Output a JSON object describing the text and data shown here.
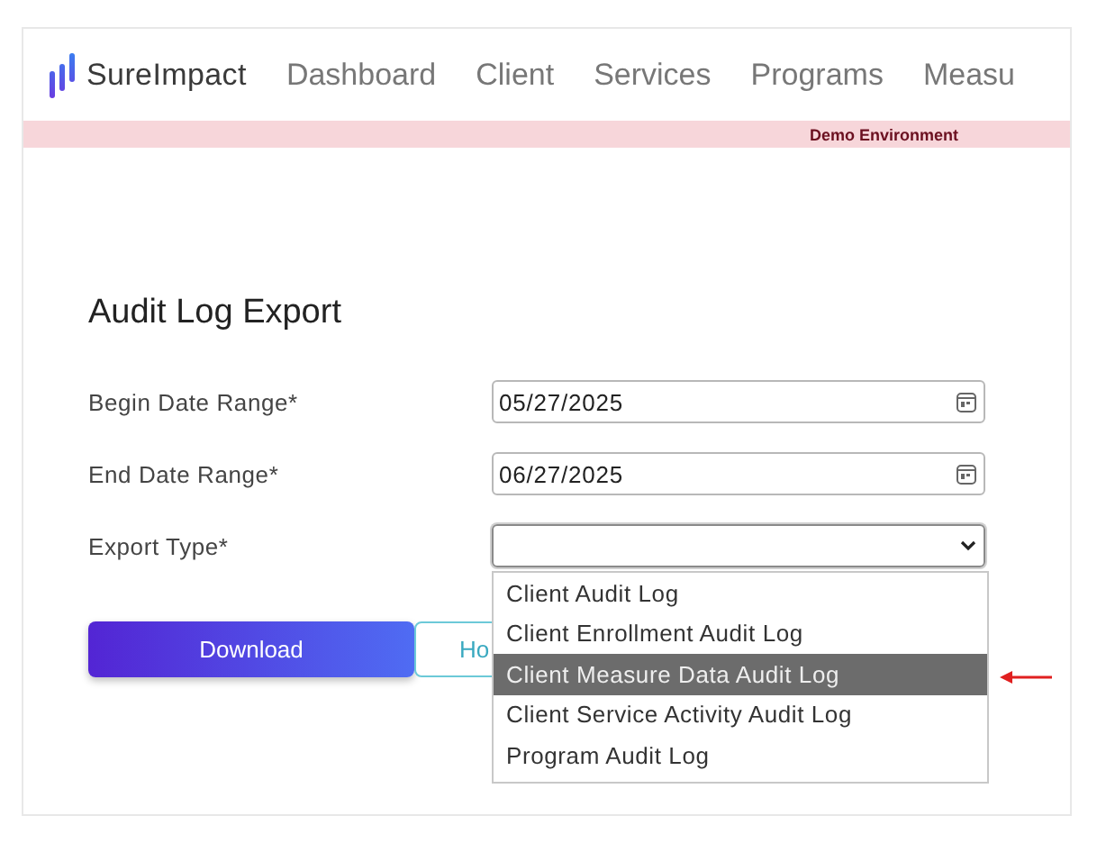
{
  "brand": {
    "name": "SureImpact"
  },
  "nav": [
    {
      "label": "Dashboard"
    },
    {
      "label": "Client"
    },
    {
      "label": "Services"
    },
    {
      "label": "Programs"
    },
    {
      "label": "Measu"
    }
  ],
  "banner": "Demo Environment",
  "heading": "Audit Log Export",
  "fields": [
    {
      "kind": "date",
      "label": "Begin Date Range*",
      "value": "05/27/2025"
    },
    {
      "kind": "date",
      "label": "End Date Range*",
      "value": "06/27/2025"
    },
    {
      "kind": "select",
      "label": "Export Type*",
      "expanded": true
    }
  ],
  "options": [
    {
      "label": "Client Audit Log",
      "selected": false
    },
    {
      "label": "Client Enrollment Audit Log",
      "selected": false
    },
    {
      "label": "Client Measure Data Audit Log",
      "selected": true
    },
    {
      "label": "Client Service Activity Audit Log",
      "selected": false
    },
    {
      "label": "Program Audit Log",
      "selected": false
    }
  ],
  "buttons": [
    {
      "kind": "primary",
      "label": "Download"
    },
    {
      "kind": "outline",
      "label": "Ho"
    }
  ]
}
